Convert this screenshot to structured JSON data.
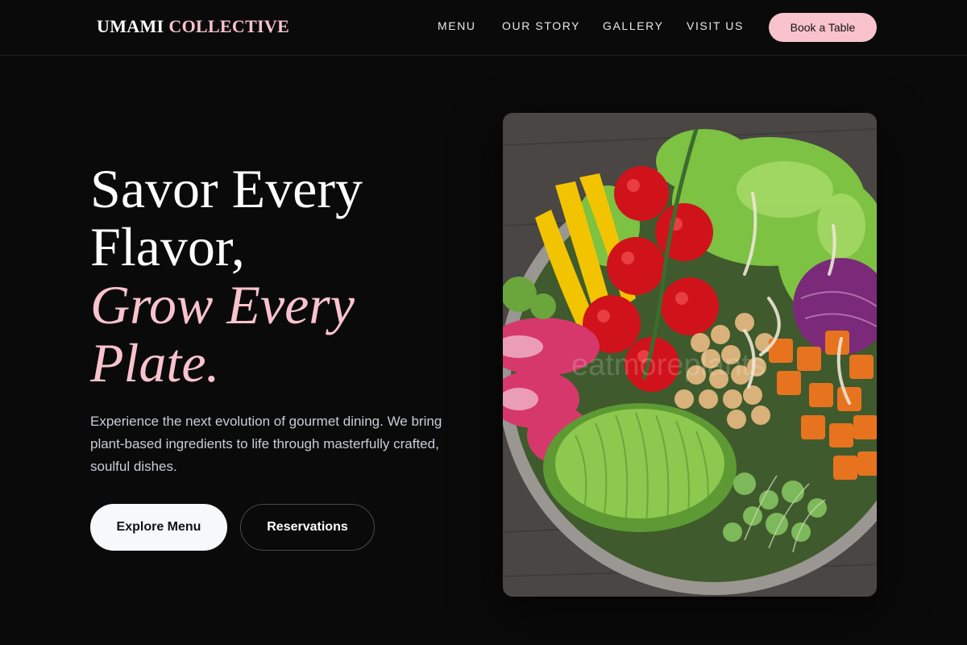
{
  "brand": {
    "word1": "UMAMI",
    "word2": "COLLECTIVE"
  },
  "nav": {
    "links": [
      "MENU",
      "OUR STORY",
      "GALLERY",
      "VISIT US"
    ],
    "cta": "Book a Table"
  },
  "hero": {
    "title_lines": [
      "Savor Every",
      "Flavor,"
    ],
    "title_accent_lines": [
      "Grow Every",
      "Plate."
    ],
    "description": "Experience the next evolution of gourmet dining. We bring plant-based ingredients to life through masterfully crafted, soulful dishes.",
    "primary_button": "Explore Menu",
    "secondary_button": "Reservations"
  },
  "image": {
    "watermark": "eatmoreplants"
  },
  "colors": {
    "accent": "#f9c3cd",
    "background": "#0a0a0a"
  }
}
